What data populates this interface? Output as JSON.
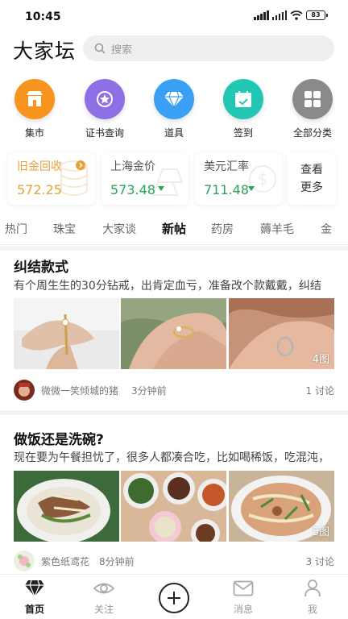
{
  "status_bar": {
    "time": "10:45",
    "battery": "83"
  },
  "header": {
    "logo": "大家坛",
    "search_placeholder": "搜索"
  },
  "quick_links": [
    {
      "label": "集市",
      "icon": "shop-icon",
      "color": "#f7941d"
    },
    {
      "label": "证书查询",
      "icon": "certificate-star-icon",
      "color": "#8f6fe6"
    },
    {
      "label": "道具",
      "icon": "diamond-icon",
      "color": "#3aa0f3"
    },
    {
      "label": "签到",
      "icon": "calendar-check-icon",
      "color": "#22c7b3"
    },
    {
      "label": "全部分类",
      "icon": "grid-icon",
      "color": "#8a8a8a"
    }
  ],
  "info_cards": [
    {
      "title": "旧金回收",
      "value": "572.25",
      "title_color": "#e8a23c",
      "value_color": "#e8a23c"
    },
    {
      "title": "上海金价",
      "value": "573.48",
      "title_color": "#555555",
      "value_color": "#2aa35a"
    },
    {
      "title": "美元汇率",
      "value": "711.48",
      "title_color": "#555555",
      "value_color": "#2aa35a"
    }
  ],
  "more_card": {
    "line1": "查看",
    "line2": "更多"
  },
  "tabs": [
    "热门",
    "珠宝",
    "大家谈",
    "新帖",
    "药房",
    "薅羊毛",
    "金"
  ],
  "active_tab": "新帖",
  "posts": [
    {
      "title": "纠结款式",
      "excerpt": "有个周生生的30分钻戒，出肯定血亏，准备改个款戴戴，纠结",
      "image_count": "4图",
      "author": "微微一笑倾城的猪",
      "time": "3分钟前",
      "discussions": "1  讨论"
    },
    {
      "title": "做饭还是洗碗?",
      "excerpt": "现在要为午餐担忧了，很多人都凑合吃，比如喝稀饭，吃混沌，",
      "image_count": "5图",
      "author": "紫色纸鸢花",
      "time": "8分钟前",
      "discussions": "3  讨论"
    }
  ],
  "bottom_nav": [
    {
      "label": "首页",
      "icon": "diamond-home-icon"
    },
    {
      "label": "关注",
      "icon": "eye-icon"
    },
    {
      "label": "",
      "icon": "plus-icon"
    },
    {
      "label": "消息",
      "icon": "mail-icon"
    },
    {
      "label": "我",
      "icon": "user-icon"
    }
  ]
}
